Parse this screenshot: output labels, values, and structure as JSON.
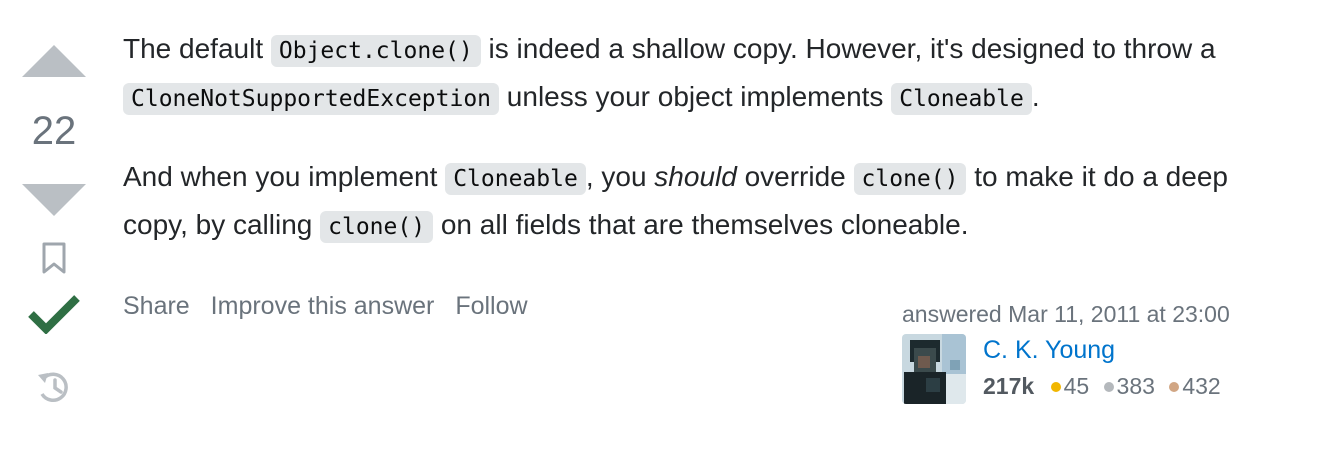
{
  "vote": {
    "count": "22"
  },
  "answer": {
    "p1": {
      "t1": "The default ",
      "c1": "Object.clone()",
      "t2": " is indeed a shallow copy. However, it's designed to throw a ",
      "c2": "CloneNotSupportedException",
      "t3": " unless your object implements ",
      "c3": "Cloneable",
      "t4": "."
    },
    "p2": {
      "t1": "And when you implement ",
      "c1": "Cloneable",
      "t2": ", you ",
      "em": "should",
      "t3": " override ",
      "c2": "clone()",
      "t4": " to make it do a deep copy, by calling ",
      "c3": "clone()",
      "t5": " on all fields that are themselves cloneable."
    }
  },
  "menu": {
    "share": "Share",
    "improve": "Improve this answer",
    "follow": "Follow"
  },
  "signature": {
    "answered": "answered Mar 11, 2011 at 23:00",
    "user_name": "C. K. Young",
    "reputation": "217k",
    "gold": "45",
    "silver": "383",
    "bronze": "432"
  },
  "colors": {
    "vote_arrow": "#babfc4",
    "accepted": "#2f6f44",
    "link": "#0074cc",
    "gold": "#f1b600",
    "silver": "#b4b8bc",
    "bronze": "#d1a684"
  },
  "icons": {
    "upvote": "triangle-up-icon",
    "downvote": "triangle-down-icon",
    "bookmark": "bookmark-icon",
    "accepted": "checkmark-icon",
    "history": "history-icon"
  }
}
